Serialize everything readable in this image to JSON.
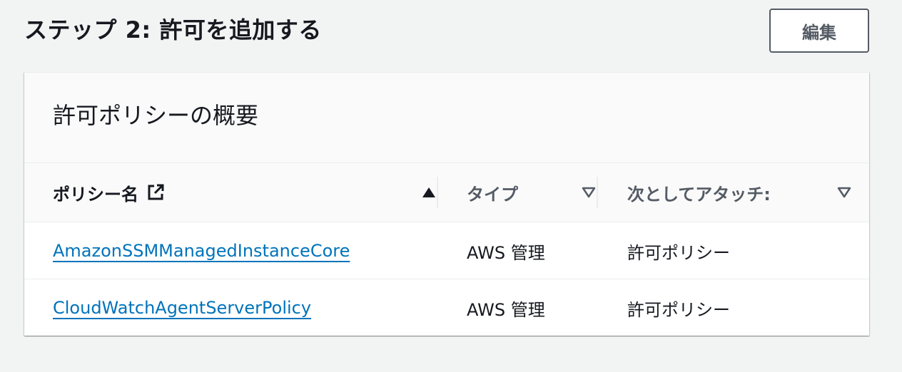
{
  "step": {
    "title": "ステップ 2: 許可を追加する",
    "edit_label": "編集"
  },
  "panel": {
    "title": "許可ポリシーの概要",
    "columns": [
      {
        "label": "ポリシー名",
        "sort": "ascending",
        "icon": "external-link-icon"
      },
      {
        "label": "タイプ",
        "sort": "descending"
      },
      {
        "label": "次としてアタッチ:",
        "sort": "descending"
      }
    ],
    "rows": [
      {
        "name": "AmazonSSMManagedInstanceCore",
        "type": "AWS 管理",
        "attached_as": "許可ポリシー"
      },
      {
        "name": "CloudWatchAgentServerPolicy",
        "type": "AWS 管理",
        "attached_as": "許可ポリシー"
      }
    ]
  },
  "colors": {
    "background": "#f2f3f3",
    "link": "#0073bb",
    "text": "#16191f",
    "muted": "#545b64"
  }
}
